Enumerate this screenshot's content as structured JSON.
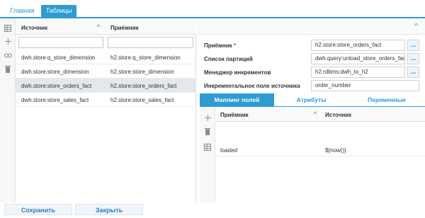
{
  "top_tabs": {
    "main": "Главная",
    "tables": "Таблицы"
  },
  "left_toolbar": [
    "table-icon",
    "add-icon",
    "link-icon",
    "trash-icon"
  ],
  "left_grid": {
    "headers": {
      "source": "Источник",
      "target": "Приёмник"
    },
    "rows": [
      {
        "source": "dwh.store:q_store_dimension",
        "target": "h2.store:q_store_dimension"
      },
      {
        "source": "dwh.store:store_dimension",
        "target": "h2.store:store_dimension"
      },
      {
        "source": "dwh.store:store_orders_fact",
        "target": "h2.store:store_orders_fact"
      },
      {
        "source": "dwh.store:store_sales_fact",
        "target": "h2.store:store_sales_fact"
      }
    ]
  },
  "form": {
    "receiver_label": "Приёмник",
    "receiver_required": "*",
    "receiver_value": "h2.store:store_orders_fact",
    "partitions_label": "Список партиций",
    "partitions_value": "dwh.query:unload_store_orders_fact",
    "increment_manager_label": "Менеджер инкрементов",
    "increment_manager_value": "h2.rdbms:dwh_to_h2",
    "increment_field_label": "Инкрементальное поле источника",
    "increment_field_value": "order_number",
    "ellipsis": "..."
  },
  "detail_tabs": {
    "mapping": "Маппинг полей",
    "attributes": "Атрибуты",
    "variables": "Переменные"
  },
  "mapping_grid": {
    "headers": {
      "receiver": "Приёмник",
      "source": "Источник"
    },
    "rows": [
      {
        "receiver": "loaded",
        "source": "${now()}"
      }
    ]
  },
  "buttons": {
    "save": "Сохранить",
    "close": "Закрыть"
  },
  "colors": {
    "accent": "#2d9bd4",
    "selected_row": "#e4e7ec",
    "required": "#e03030"
  }
}
